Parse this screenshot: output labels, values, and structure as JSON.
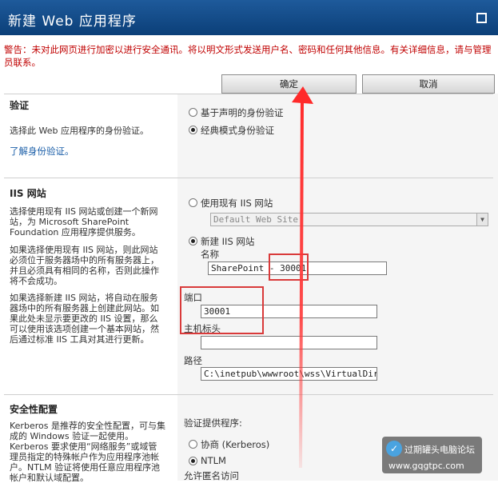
{
  "window": {
    "title": "新建 Web 应用程序",
    "warning": "警告：未对此网页进行加密以进行安全通讯。将以明文形式发送用户名、密码和任何其他信息。有关详细信息，请与管理员联系。"
  },
  "buttons": {
    "ok": "确定",
    "cancel": "取消"
  },
  "auth": {
    "heading": "验证",
    "description": "选择此 Web 应用程序的身份验证。",
    "link": "了解身份验证。",
    "option_claims": "基于声明的身份验证",
    "option_classic": "经典模式身份验证",
    "selected": "classic"
  },
  "iis": {
    "heading": "IIS 网站",
    "desc1": "选择使用现有 IIS 网站或创建一个新网站，为 Microsoft SharePoint Foundation 应用程序提供服务。",
    "desc2": "如果选择使用现有 IIS 网站，则此网站必须位于服务器场中的所有服务器上，并且必须具有相同的名称，否则此操作将不会成功。",
    "desc3": "如果选择新建 IIS 网站，将自动在服务器场中的所有服务器上创建此网站。如果此处未显示要更改的 IIS 设置，那么可以使用该选项创建一个基本网站，然后通过标准 IIS 工具对其进行更新。",
    "option_existing": "使用现有 IIS 网站",
    "existing_site_value": "Default Web Site",
    "option_new": "新建 IIS 网站",
    "selected": "new",
    "name_label": "名称",
    "name_value": "SharePoint - 30001",
    "port_label": "端口",
    "port_value": "30001",
    "host_header_label": "主机标头",
    "host_header_value": "",
    "path_label": "路径",
    "path_value": "C:\\inetpub\\wwwroot\\wss\\VirtualDirect"
  },
  "security": {
    "heading": "安全性配置",
    "description": "Kerberos 是推荐的安全性配置，可与集成的 Windows 验证一起使用。Kerberos 要求使用“网络服务”或域管理员指定的特殊帐户作为应用程序池帐户。NTLM 验证将使用任意应用程序池帐户和默认域配置。",
    "provider_label": "验证提供程序:",
    "option_kerberos": "协商 (Kerberos)",
    "option_ntlm": "NTLM",
    "selected": "ntlm",
    "anonymous_label": "允许匿名访问"
  },
  "watermark": {
    "line1": "过期罐头电脑论坛",
    "line2": "www.gqgtpc.com"
  },
  "colors": {
    "titlebar": "#0b3f78",
    "warning": "#c00000",
    "annotation": "#d93a3a",
    "link": "#1a5ea8"
  }
}
